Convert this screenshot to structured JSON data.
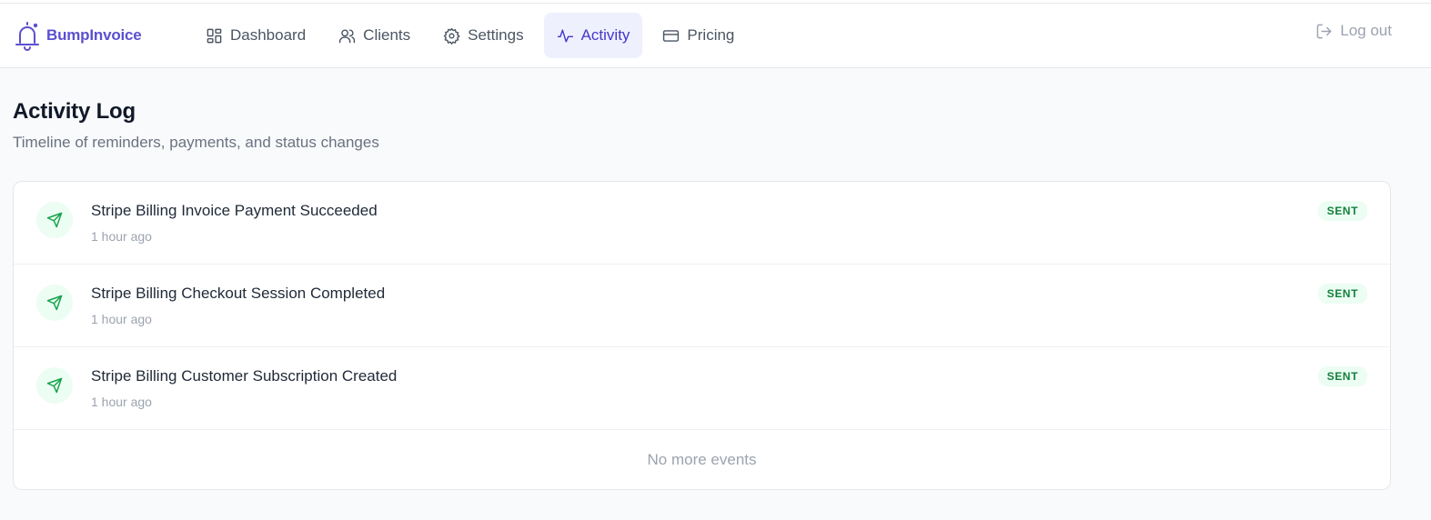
{
  "brand": {
    "name": "BumpInvoice",
    "color": "#5b4fcf"
  },
  "nav": {
    "items": [
      {
        "label": "Dashboard",
        "icon": "dashboard-grid-icon"
      },
      {
        "label": "Clients",
        "icon": "users-icon"
      },
      {
        "label": "Settings",
        "icon": "gear-icon"
      },
      {
        "label": "Activity",
        "icon": "activity-pulse-icon",
        "active": true
      },
      {
        "label": "Pricing",
        "icon": "credit-card-icon"
      }
    ],
    "logout_label": "Log out"
  },
  "page": {
    "title": "Activity Log",
    "subtitle": "Timeline of reminders, payments, and status changes"
  },
  "events": [
    {
      "title": "Stripe Billing Invoice Payment Succeeded",
      "time": "1 hour ago",
      "status": "SENT",
      "icon": "send-icon"
    },
    {
      "title": "Stripe Billing Checkout Session Completed",
      "time": "1 hour ago",
      "status": "SENT",
      "icon": "send-icon"
    },
    {
      "title": "Stripe Billing Customer Subscription Created",
      "time": "1 hour ago",
      "status": "SENT",
      "icon": "send-icon"
    }
  ],
  "footer_text": "No more events",
  "colors": {
    "accent": "#4338ca",
    "active_bg": "#eef0fd",
    "success": "#16a34a",
    "success_bg": "#ecfdf3"
  }
}
